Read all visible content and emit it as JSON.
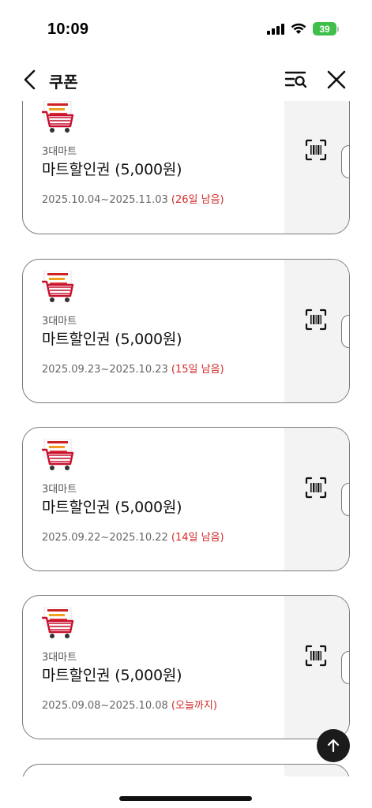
{
  "status_bar": {
    "time": "10:09",
    "battery": "39"
  },
  "header": {
    "title": "쿠폰"
  },
  "coupons": [
    {
      "brand": "3대마트",
      "name": "마트할인권 (5,000원)",
      "period": "2025.10.04~2025.11.03",
      "remaining": "(26일 남음)"
    },
    {
      "brand": "3대마트",
      "name": "마트할인권 (5,000원)",
      "period": "2025.09.23~2025.10.23",
      "remaining": "(15일 남음)"
    },
    {
      "brand": "3대마트",
      "name": "마트할인권 (5,000원)",
      "period": "2025.09.22~2025.10.22",
      "remaining": "(14일 남음)"
    },
    {
      "brand": "3대마트",
      "name": "마트할인권 (5,000원)",
      "period": "2025.09.08~2025.10.08",
      "remaining": "(오늘까지)"
    }
  ],
  "colors": {
    "remaining_text": "#d12a2a",
    "card_side": "#f3f3f3",
    "battery": "#3fbf4a",
    "card_border": "#7a7a7a"
  },
  "icons": {
    "back": "chevron-left-icon",
    "filter": "filter-search-icon",
    "close": "close-icon",
    "barcode": "barcode-scan-icon",
    "scroll_top": "arrow-up-icon",
    "logo": "mart-cart-logo-icon"
  }
}
